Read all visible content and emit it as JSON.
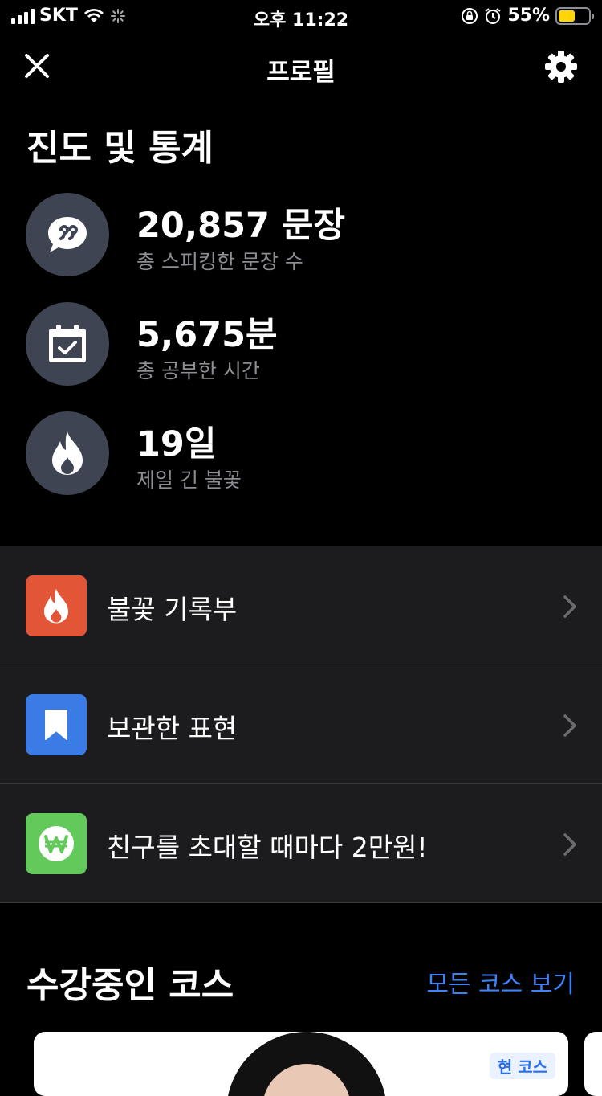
{
  "status_bar": {
    "carrier": "SKT",
    "time": "오후 11:22",
    "battery": "55%",
    "battery_level": 0.55
  },
  "nav": {
    "title": "프로필",
    "close_icon": "close-icon",
    "settings_icon": "gear-icon"
  },
  "stats": {
    "title": "진도 및 통계",
    "items": [
      {
        "value": "20,857 문장",
        "label": "총 스피킹한 문장 수",
        "icon": "speech-bubble-icon"
      },
      {
        "value": "5,675분",
        "label": "총 공부한 시간",
        "icon": "calendar-check-icon"
      },
      {
        "value": "19일",
        "label": "제일 긴 불꽃",
        "icon": "flame-icon"
      }
    ]
  },
  "menu": {
    "items": [
      {
        "label": "불꽃 기록부",
        "icon": "flame-icon",
        "color": "#e35537"
      },
      {
        "label": "보관한 표현",
        "icon": "bookmark-icon",
        "color": "#3a7be6"
      },
      {
        "label": "친구를 초대할 때마다 2만원!",
        "icon": "won-icon",
        "color": "#63c95b"
      }
    ]
  },
  "courses": {
    "title": "수강중인 코스",
    "see_all": "모든 코스 보기",
    "card_badge": "현 코스"
  },
  "colors": {
    "accent_blue": "#3e82f7",
    "stat_circle": "#3f4452",
    "menu_bg": "#1c1c1e"
  }
}
